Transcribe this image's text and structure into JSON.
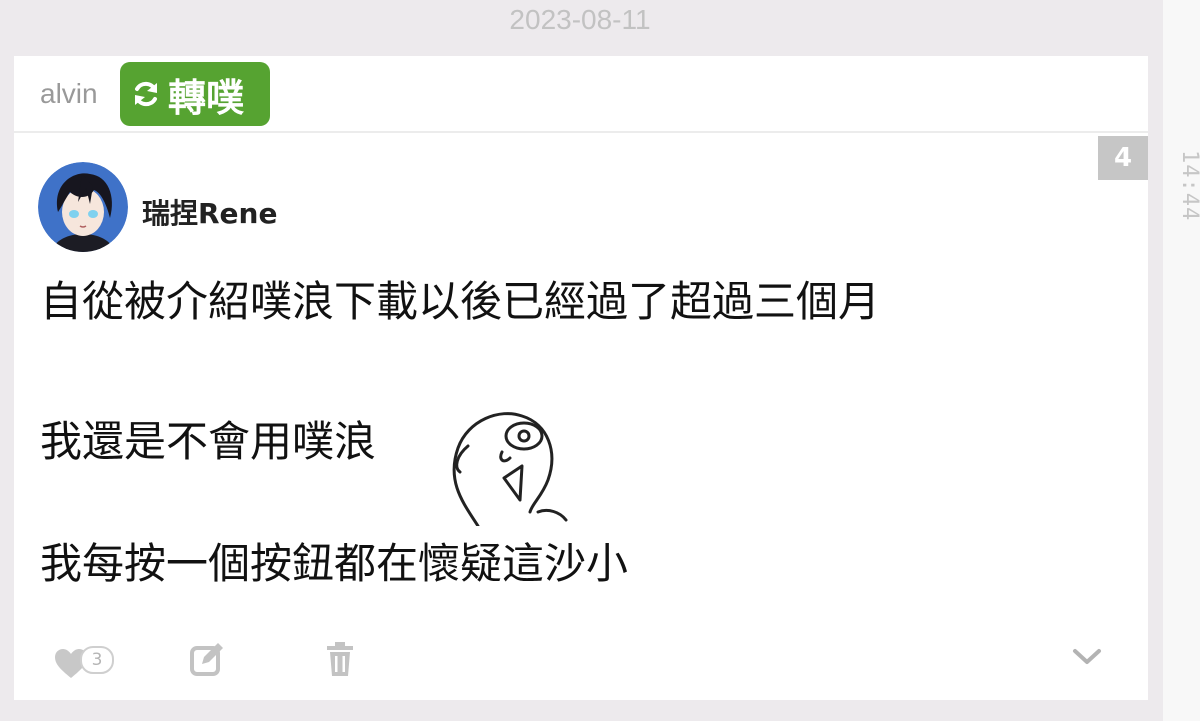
{
  "date": "2023-08-11",
  "time": "14:44",
  "replurk": {
    "user": "alvin",
    "label": "轉噗"
  },
  "plurk": {
    "response_count": "4",
    "author": "瑞捏Rene",
    "lines": [
      "自從被介紹噗浪下載以後已經過了超過三個月",
      "我還是不會用噗浪",
      "我每按一個按鈕都在懷疑這沙小"
    ],
    "likes": "3"
  },
  "icons": {
    "replurk": "refresh-icon",
    "like": "heart-icon",
    "edit": "edit-icon",
    "delete": "trash-icon",
    "expand": "chevron-down-icon"
  },
  "colors": {
    "accent": "#56a331",
    "background": "#edeaed",
    "muted": "#c6c6c6"
  }
}
